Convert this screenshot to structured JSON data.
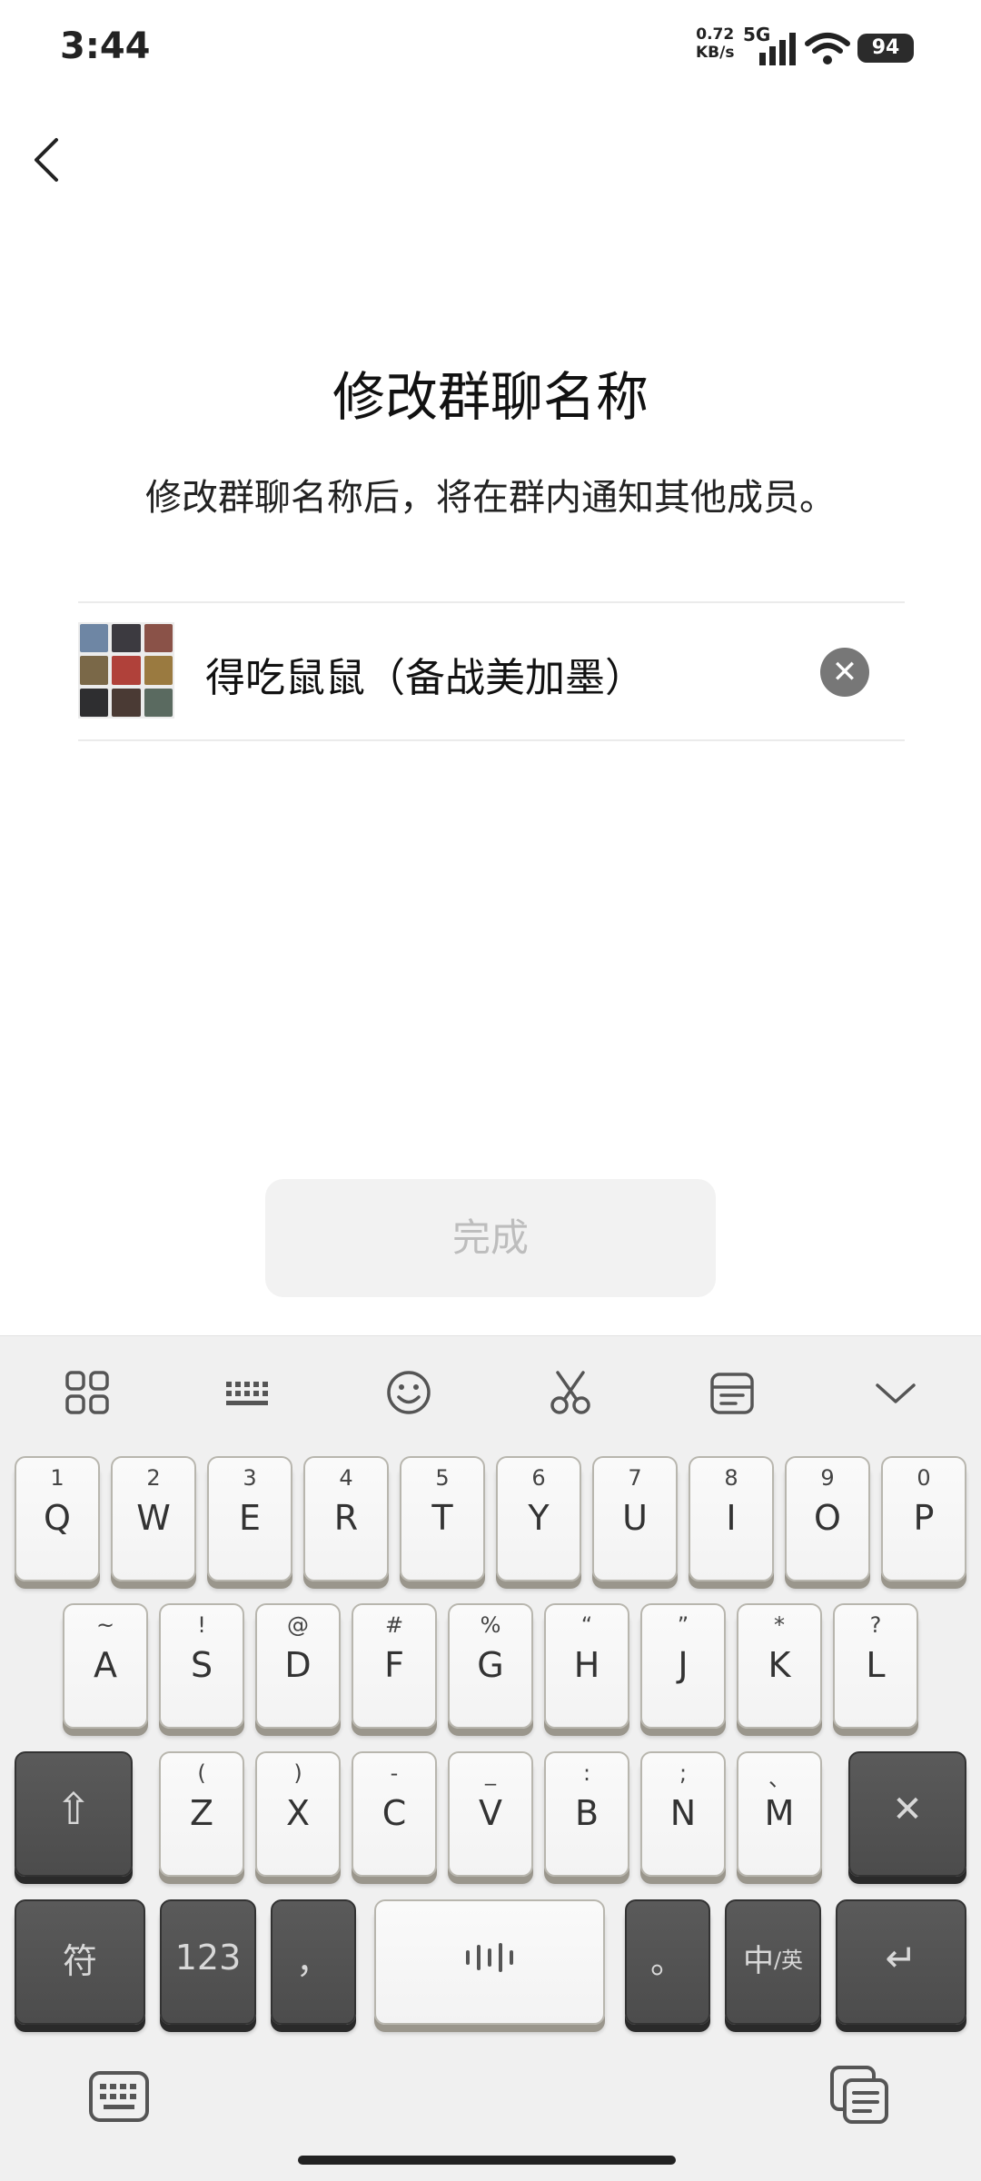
{
  "status_bar": {
    "time": "3:44",
    "net_speed_value": "0.72",
    "net_speed_unit": "KB/s",
    "net_type": "5G",
    "battery": "94"
  },
  "page": {
    "title": "修改群聊名称",
    "subtitle": "修改群聊名称后，将在群内通知其他成员。",
    "group_name": "得吃鼠鼠（备战美加墨）",
    "done_label": "完成"
  },
  "avatar_colors": [
    "#6e86a4",
    "#3c3a40",
    "#8a5248",
    "#7a6848",
    "#b0413a",
    "#9a7a40",
    "#2e2e30",
    "#4a3a34",
    "#5a6a60"
  ],
  "keyboard": {
    "toolbar_icons": [
      "grid-icon",
      "keyboard-layout-icon",
      "emoji-icon",
      "scissors-icon",
      "clipboard-icon",
      "chevron-down-icon"
    ],
    "row1": [
      {
        "sub": "1",
        "main": "Q"
      },
      {
        "sub": "2",
        "main": "W"
      },
      {
        "sub": "3",
        "main": "E"
      },
      {
        "sub": "4",
        "main": "R"
      },
      {
        "sub": "5",
        "main": "T"
      },
      {
        "sub": "6",
        "main": "Y"
      },
      {
        "sub": "7",
        "main": "U"
      },
      {
        "sub": "8",
        "main": "I"
      },
      {
        "sub": "9",
        "main": "O"
      },
      {
        "sub": "0",
        "main": "P"
      }
    ],
    "row2": [
      {
        "sub": "~",
        "main": "A"
      },
      {
        "sub": "!",
        "main": "S"
      },
      {
        "sub": "@",
        "main": "D"
      },
      {
        "sub": "#",
        "main": "F"
      },
      {
        "sub": "%",
        "main": "G"
      },
      {
        "sub": "“",
        "main": "H"
      },
      {
        "sub": "”",
        "main": "J"
      },
      {
        "sub": "*",
        "main": "K"
      },
      {
        "sub": "?",
        "main": "L"
      }
    ],
    "row3": [
      {
        "sub": "(",
        "main": "Z"
      },
      {
        "sub": ")",
        "main": "X"
      },
      {
        "sub": "-",
        "main": "C"
      },
      {
        "sub": "_",
        "main": "V"
      },
      {
        "sub": ":",
        "main": "B"
      },
      {
        "sub": ";",
        "main": "N"
      },
      {
        "sub": "、",
        "main": "M"
      }
    ],
    "symbols_label": "符",
    "numbers_label": "123",
    "comma_label": "，",
    "period_label": "。",
    "lang_label_cn": "中",
    "lang_label_en": "/英",
    "shift_symbol": "⇧",
    "delete_symbol": "✕",
    "enter_symbol": "↵",
    "clear_symbol": "✕"
  }
}
